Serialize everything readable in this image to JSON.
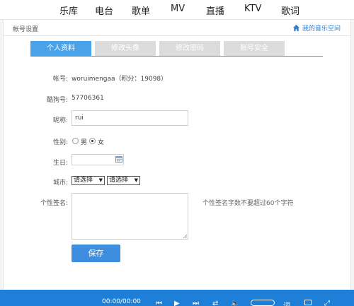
{
  "nav": {
    "items": [
      "乐库",
      "电台",
      "歌单",
      "MV",
      "直播",
      "KTV",
      "歌词"
    ]
  },
  "panel": {
    "title": "帐号设置",
    "my_space": "我的音乐空间"
  },
  "tabs": [
    {
      "label": "个人资料",
      "active": true
    },
    {
      "label": "修改头像",
      "active": false
    },
    {
      "label": "修改密码",
      "active": false
    },
    {
      "label": "账号安全",
      "active": false
    }
  ],
  "form": {
    "account_label": "帐号:",
    "account_value": "woruimengaa（积分：19098）",
    "kugou_label": "酷狗号:",
    "kugou_value": "57706361",
    "nickname_label": "昵称:",
    "nickname_value": "rui",
    "gender_label": "性别:",
    "gender_male": "男",
    "gender_female": "女",
    "gender_selected": "女",
    "birthday_label": "生日:",
    "birthday_value": "",
    "city_label": "城市:",
    "province_select": "请选择",
    "city_select": "请选择",
    "signature_label": "个性签名:",
    "signature_value": "",
    "signature_hint": "个性签名字数不要超过60个字符",
    "save_label": "保存"
  },
  "player": {
    "time": "00:00/00:00"
  },
  "colors": {
    "accent": "#3e8ee0",
    "tab_active": "#4aa3e8",
    "tab_inactive": "#dcdcdc",
    "player_bar": "#1d7fd7",
    "link": "#2c7fd1"
  }
}
